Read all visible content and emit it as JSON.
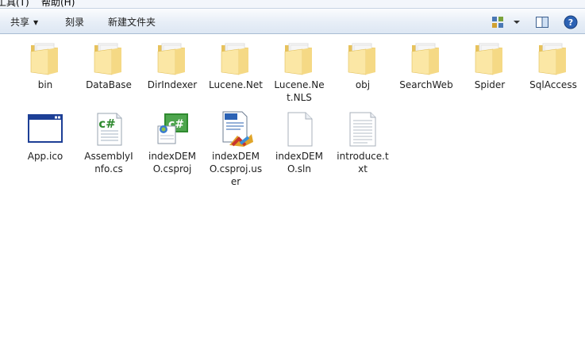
{
  "menubar": {
    "items": [
      "工具(T)",
      "帮助(H)"
    ]
  },
  "toolbar": {
    "share_label": "共享",
    "burn_label": "刻录",
    "new_folder_label": "新建文件夹",
    "icons": [
      "view-options-icon",
      "chevron-down-icon",
      "preview-pane-icon",
      "help-icon"
    ]
  },
  "colors": {
    "toolbar_top": "#fbfcfe",
    "toolbar_bottom": "#dde7f3",
    "folder_light": "#fbe7a5",
    "folder_dark": "#e7c25c",
    "cs_green": "#2f8a2f"
  },
  "files": [
    {
      "label": "bin",
      "kind": "folder"
    },
    {
      "label": "DataBase",
      "kind": "folder"
    },
    {
      "label": "DirIndexer",
      "kind": "folder"
    },
    {
      "label": "Lucene.Net",
      "kind": "folder"
    },
    {
      "label": "Lucene.Net.NLS",
      "kind": "folder"
    },
    {
      "label": "obj",
      "kind": "folder"
    },
    {
      "label": "SearchWeb",
      "kind": "folder"
    },
    {
      "label": "Spider",
      "kind": "folder"
    },
    {
      "label": "SqlAccess",
      "kind": "folder"
    },
    {
      "label": "App.ico",
      "kind": "ico-file"
    },
    {
      "label": "AssemblyInfo.cs",
      "kind": "cs-file"
    },
    {
      "label": "indexDEMO.csproj",
      "kind": "csproj-file"
    },
    {
      "label": "indexDEMO.csproj.user",
      "kind": "user-file"
    },
    {
      "label": "indexDEMO.sln",
      "kind": "blank-file"
    },
    {
      "label": "introduce.txt",
      "kind": "text-file"
    }
  ]
}
